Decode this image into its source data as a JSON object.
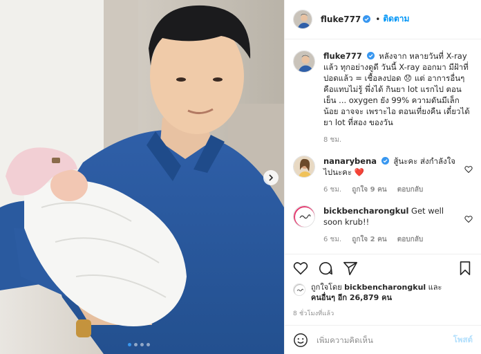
{
  "colors": {
    "accent": "#0095f6",
    "verified": "#3897f0",
    "muted": "#8e8e8e",
    "heart": "#ed4956"
  },
  "header": {
    "username": "fluke777",
    "separator": "•",
    "follow_label": "ติดตาม",
    "verified_icon": "verified-badge-icon"
  },
  "caption": {
    "username": "fluke777",
    "text": "หลังจาก หลายวันที่ X-ray แล้ว ทุกอย่างดูดี วันนี้ X-ray ออกมา มีฝ้าที่ปอดแล้ว = เชื้อลงปอด 😞 แต่ อาการอื่นๆ คือแทบไม่รู้ พึ่งได้ กินยา lot แรกไป ตอนเย็น ... oxygen ยัง 99% ความดันมีเล็กน้อย อาจจะ เพราะไอ ตอนเที่ยงคืน เดี๋ยวได้ยา lot ที่สอง ของวัน",
    "time": "8 ชม."
  },
  "comments": [
    {
      "username": "nanarybena",
      "text": "สู้นะคะ ส่งกำลังใจไปนะคะ",
      "emoji": "❤️",
      "time": "6 ชม.",
      "likes": "ถูกใจ 9 คน",
      "reply_label": "ตอบกลับ"
    },
    {
      "username": "bickbencharongkul",
      "text": "Get well soon krub!!",
      "time": "6 ชม.",
      "likes": "ถูกใจ 2 คน",
      "reply_label": "ตอบกลับ"
    }
  ],
  "likes": {
    "prefix": "ถูกใจโดย",
    "first_user": "bickbencharongkul",
    "and": "และ",
    "others": "คนอื่นๆ อีก 26,879 คน"
  },
  "timestamp": "8 ชั่วโมงที่แล้ว",
  "composer": {
    "placeholder": "เพิ่มความคิดเห็น",
    "post_label": "โพสต์"
  },
  "carousel": {
    "total": 4,
    "active": 1
  }
}
